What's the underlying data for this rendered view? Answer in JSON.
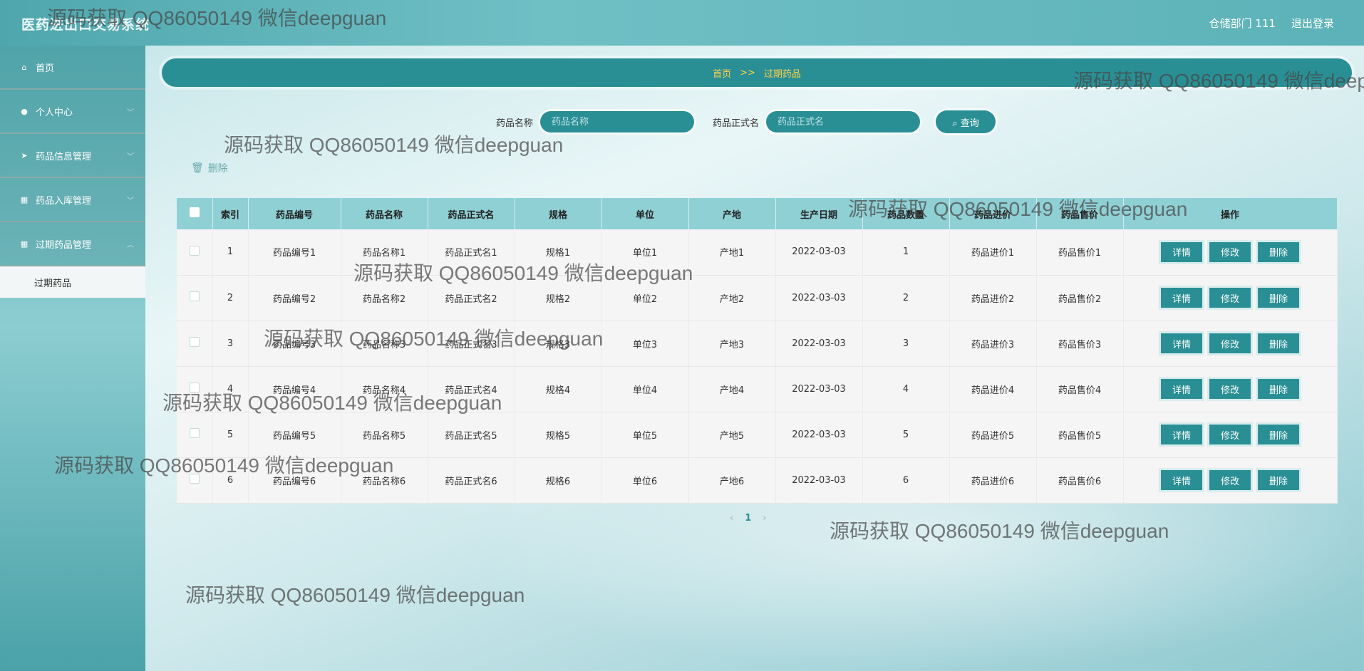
{
  "header": {
    "app_title": "医药进出口交易系统",
    "user_label": "仓储部门 111",
    "logout_label": "退出登录"
  },
  "sidebar": {
    "items": [
      {
        "label": "首页",
        "icon": "home-icon"
      },
      {
        "label": "个人中心",
        "icon": "user-icon"
      },
      {
        "label": "药品信息管理",
        "icon": "send-icon"
      },
      {
        "label": "药品入库管理",
        "icon": "grid-icon"
      },
      {
        "label": "过期药品管理",
        "icon": "grid-icon"
      }
    ],
    "sub_item": "过期药品"
  },
  "breadcrumb": {
    "home": "首页",
    "separator": ">>",
    "current": "过期药品"
  },
  "search": {
    "name_label": "药品名称",
    "name_placeholder": "药品名称",
    "formal_label": "药品正式名",
    "formal_placeholder": "药品正式名",
    "query_label": "查询"
  },
  "toolbar": {
    "delete_label": "删除"
  },
  "table": {
    "headers": [
      "索引",
      "药品编号",
      "药品名称",
      "药品正式名",
      "规格",
      "单位",
      "产地",
      "生产日期",
      "药品数量",
      "药品进价",
      "药品售价",
      "操作"
    ],
    "rows": [
      [
        "1",
        "药品编号1",
        "药品名称1",
        "药品正式名1",
        "规格1",
        "单位1",
        "产地1",
        "2022-03-03",
        "1",
        "药品进价1",
        "药品售价1"
      ],
      [
        "2",
        "药品编号2",
        "药品名称2",
        "药品正式名2",
        "规格2",
        "单位2",
        "产地2",
        "2022-03-03",
        "2",
        "药品进价2",
        "药品售价2"
      ],
      [
        "3",
        "药品编号3",
        "药品名称3",
        "药品正式名3",
        "规格3",
        "单位3",
        "产地3",
        "2022-03-03",
        "3",
        "药品进价3",
        "药品售价3"
      ],
      [
        "4",
        "药品编号4",
        "药品名称4",
        "药品正式名4",
        "规格4",
        "单位4",
        "产地4",
        "2022-03-03",
        "4",
        "药品进价4",
        "药品售价4"
      ],
      [
        "5",
        "药品编号5",
        "药品名称5",
        "药品正式名5",
        "规格5",
        "单位5",
        "产地5",
        "2022-03-03",
        "5",
        "药品进价5",
        "药品售价5"
      ],
      [
        "6",
        "药品编号6",
        "药品名称6",
        "药品正式名6",
        "规格6",
        "单位6",
        "产地6",
        "2022-03-03",
        "6",
        "药品进价6",
        "药品售价6"
      ]
    ],
    "actions": [
      "详情",
      "修改",
      "删除"
    ]
  },
  "pagination": {
    "prev": "‹",
    "current": "1",
    "next": "›"
  },
  "watermark": "源码获取 QQ86050149 微信deepguan",
  "colors": {
    "accent": "#2a8f95",
    "header_row": "#8fd0d5",
    "breadcrumb_text": "#ffd24a"
  }
}
